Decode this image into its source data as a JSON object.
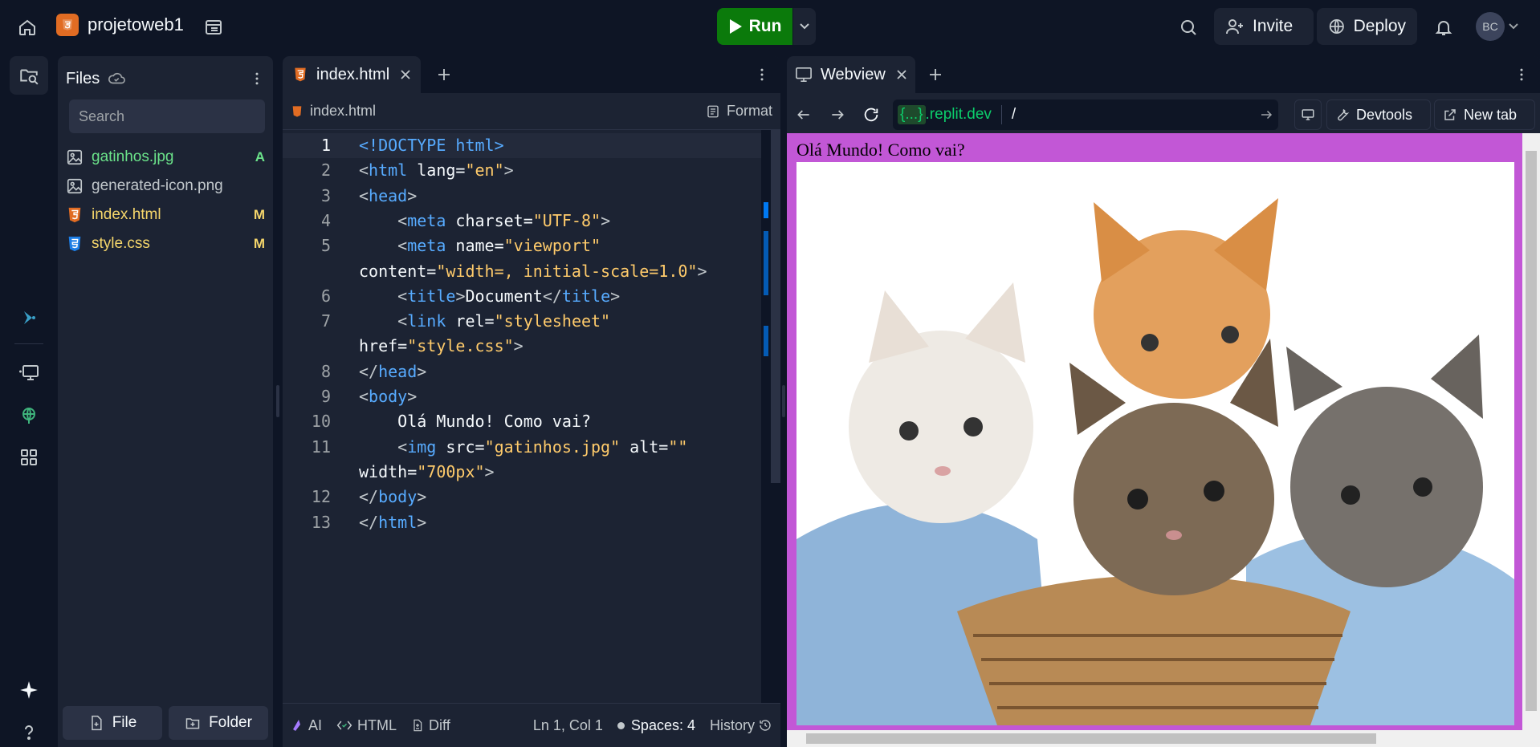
{
  "topbar": {
    "project_name": "projetoweb1",
    "run_label": "Run",
    "invite_label": "Invite",
    "deploy_label": "Deploy",
    "avatar_initials": "BC"
  },
  "files_panel": {
    "title": "Files",
    "search_placeholder": "Search",
    "items": [
      {
        "name": "gatinhos.jpg",
        "badge": "A",
        "color": "#6be38a",
        "badge_color": "#6be38a",
        "icon": "image-icon"
      },
      {
        "name": "generated-icon.png",
        "badge": "",
        "color": "#c2c8cc",
        "badge_color": "#c2c8cc",
        "icon": "image-icon"
      },
      {
        "name": "index.html",
        "badge": "M",
        "color": "#f5d66b",
        "badge_color": "#f5d66b",
        "icon": "html5-icon"
      },
      {
        "name": "style.css",
        "badge": "M",
        "color": "#f5d66b",
        "badge_color": "#f5d66b",
        "icon": "css3-icon"
      }
    ],
    "new_file_label": "File",
    "new_folder_label": "Folder"
  },
  "editor": {
    "tab_label": "index.html",
    "breadcrumb": "index.html",
    "format_label": "Format",
    "status": {
      "ai_label": "AI",
      "language_label": "HTML",
      "diff_label": "Diff",
      "cursor_position": "Ln 1, Col 1",
      "indent_label": "Spaces: 4",
      "history_label": "History"
    }
  },
  "code_lines": [
    {
      "n": "1",
      "wrap": false,
      "tokens": [
        [
          "tk-doc",
          "<!DOCTYPE html>"
        ]
      ]
    },
    {
      "n": "2",
      "wrap": false,
      "tokens": [
        [
          "tk-punct",
          "<"
        ],
        [
          "tk-tag",
          "html"
        ],
        [
          "tk-attr",
          " lang="
        ],
        [
          "tk-str",
          "\"en\""
        ],
        [
          "tk-punct",
          ">"
        ]
      ]
    },
    {
      "n": "3",
      "wrap": false,
      "tokens": [
        [
          "tk-punct",
          "<"
        ],
        [
          "tk-tag",
          "head"
        ],
        [
          "tk-punct",
          ">"
        ]
      ]
    },
    {
      "n": "4",
      "wrap": false,
      "tokens": [
        [
          "tk-punct",
          "    <"
        ],
        [
          "tk-tag",
          "meta"
        ],
        [
          "tk-attr",
          " charset="
        ],
        [
          "tk-str",
          "\"UTF-8\""
        ],
        [
          "tk-punct",
          ">"
        ]
      ]
    },
    {
      "n": "5",
      "wrap": false,
      "tokens": [
        [
          "tk-punct",
          "    <"
        ],
        [
          "tk-tag",
          "meta"
        ],
        [
          "tk-attr",
          " name="
        ],
        [
          "tk-str",
          "\"viewport\""
        ]
      ]
    },
    {
      "n": "",
      "wrap": true,
      "tokens": [
        [
          "tk-attr",
          "content="
        ],
        [
          "tk-str",
          "\"width=, initial-scale=1.0\""
        ],
        [
          "tk-punct",
          ">"
        ]
      ]
    },
    {
      "n": "6",
      "wrap": false,
      "tokens": [
        [
          "tk-punct",
          "    <"
        ],
        [
          "tk-tag",
          "title"
        ],
        [
          "tk-punct",
          ">"
        ],
        [
          "tk-attr",
          "Document"
        ],
        [
          "tk-punct",
          "</"
        ],
        [
          "tk-tag",
          "title"
        ],
        [
          "tk-punct",
          ">"
        ]
      ]
    },
    {
      "n": "7",
      "wrap": false,
      "tokens": [
        [
          "tk-punct",
          "    <"
        ],
        [
          "tk-tag",
          "link"
        ],
        [
          "tk-attr",
          " rel="
        ],
        [
          "tk-str",
          "\"stylesheet\""
        ]
      ]
    },
    {
      "n": "",
      "wrap": true,
      "tokens": [
        [
          "tk-attr",
          "href="
        ],
        [
          "tk-str",
          "\"style.css\""
        ],
        [
          "tk-punct",
          ">"
        ]
      ]
    },
    {
      "n": "8",
      "wrap": false,
      "tokens": [
        [
          "tk-punct",
          "</"
        ],
        [
          "tk-tag",
          "head"
        ],
        [
          "tk-punct",
          ">"
        ]
      ]
    },
    {
      "n": "9",
      "wrap": false,
      "tokens": [
        [
          "tk-punct",
          "<"
        ],
        [
          "tk-tag",
          "body"
        ],
        [
          "tk-punct",
          ">"
        ]
      ]
    },
    {
      "n": "10",
      "wrap": false,
      "tokens": [
        [
          "tk-attr",
          "    Olá Mundo! Como vai?"
        ]
      ]
    },
    {
      "n": "11",
      "wrap": false,
      "tokens": [
        [
          "tk-punct",
          "    <"
        ],
        [
          "tk-tag",
          "img"
        ],
        [
          "tk-attr",
          " src="
        ],
        [
          "tk-str",
          "\"gatinhos.jpg\""
        ],
        [
          "tk-attr",
          " alt="
        ],
        [
          "tk-str",
          "\"\""
        ]
      ]
    },
    {
      "n": "",
      "wrap": true,
      "tokens": [
        [
          "tk-attr",
          "width="
        ],
        [
          "tk-str",
          "\"700px\""
        ],
        [
          "tk-punct",
          ">"
        ]
      ]
    },
    {
      "n": "12",
      "wrap": false,
      "tokens": [
        [
          "tk-punct",
          "</"
        ],
        [
          "tk-tag",
          "body"
        ],
        [
          "tk-punct",
          ">"
        ]
      ]
    },
    {
      "n": "13",
      "wrap": false,
      "tokens": [
        [
          "tk-punct",
          "</"
        ],
        [
          "tk-tag",
          "html"
        ],
        [
          "tk-punct",
          ">"
        ]
      ]
    }
  ],
  "webview": {
    "tab_label": "Webview",
    "url_host_braces": "{...}",
    "url_host_domain": ".replit.dev",
    "url_path": "/",
    "devtools_label": "Devtools",
    "new_tab_label": "New tab",
    "page_text": "Olá Mundo! Como vai?"
  },
  "colors": {
    "bg": "#0e1525",
    "panel": "#1c2333",
    "run_green": "#0b7a0b",
    "page_bg": "#c257d6"
  }
}
